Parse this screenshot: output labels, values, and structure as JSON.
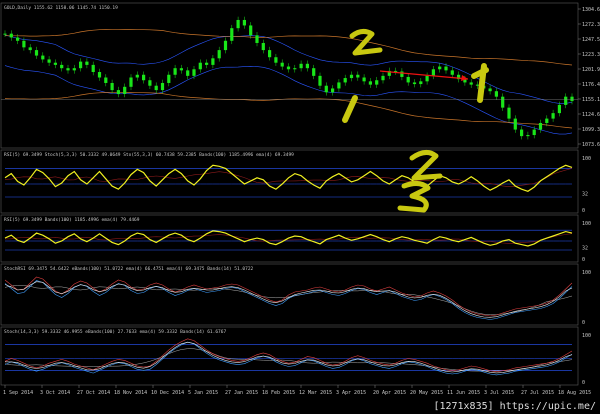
{
  "watermark": "[1271x835] https://upic.me/",
  "colors": {
    "bg": "#000000",
    "candle": "#19e619",
    "band": "#2a56ff",
    "envelope": "#c8742a",
    "yellow": "#f0f020",
    "annot_yellow": "#c8c810",
    "red": "#e11",
    "grid": "#4a4a4a"
  },
  "chart_data": [
    {
      "type": "candlestick",
      "header": "GOLD,Daily  1155.62 1158.06 1145.74 1150.19",
      "ylim": [
        1073.65,
        1320
      ],
      "y_ticks": [
        "1304.65",
        "1272.35",
        "1247.55",
        "1223.35",
        "1201.95",
        "1176.40",
        "1155.19",
        "1124.65",
        "1099.35",
        "1073.65"
      ],
      "current_price": "1155.19",
      "x_ticks": [
        "1 Sep 2014",
        "3 Oct 2014",
        "27 Oct 2014",
        "18 Nov 2014",
        "10 Dec 2014",
        "5 Jan 2015",
        "27 Jan 2015",
        "18 Feb 2015",
        "12 Mar 2015",
        "3 Apr 2015",
        "20 Apr 2015",
        "20 May 2015",
        "11 Jun 2015",
        "3 Jul 2015",
        "27 Jul 2015",
        "18 Aug 2015"
      ],
      "close": [
        1275,
        1268,
        1262,
        1250,
        1245,
        1235,
        1228,
        1222,
        1218,
        1212,
        1208,
        1212,
        1224,
        1218,
        1205,
        1195,
        1185,
        1172,
        1165,
        1178,
        1195,
        1200,
        1190,
        1180,
        1172,
        1185,
        1200,
        1212,
        1208,
        1198,
        1210,
        1222,
        1218,
        1230,
        1245,
        1262,
        1285,
        1300,
        1290,
        1272,
        1258,
        1245,
        1232,
        1222,
        1215,
        1210,
        1212,
        1220,
        1212,
        1198,
        1180,
        1168,
        1175,
        1186,
        1194,
        1200,
        1195,
        1188,
        1182,
        1190,
        1198,
        1207,
        1206,
        1196,
        1186,
        1183,
        1188,
        1198,
        1210,
        1215,
        1208,
        1200,
        1192,
        1186,
        1182,
        1180,
        1175,
        1170,
        1160,
        1140,
        1120,
        1100,
        1088,
        1090,
        1100,
        1112,
        1120,
        1130,
        1145,
        1160,
        1152
      ]
    },
    {
      "type": "line",
      "header": "RSI(5) 69.3499  Stoch(5,3,3) 50.3332  49.0649  Sto(55,3,3) 60.7438 59.2385  Bands(100) 1185.4996  ema(4) 69.3499",
      "ylim": [
        0,
        100
      ],
      "y_ticks": [
        "100",
        "32",
        "0"
      ],
      "series_color": "yellow",
      "values": [
        62,
        70,
        55,
        48,
        62,
        78,
        72,
        60,
        45,
        52,
        66,
        74,
        58,
        50,
        62,
        74,
        60,
        46,
        40,
        52,
        68,
        78,
        72,
        56,
        46,
        58,
        70,
        78,
        70,
        56,
        48,
        60,
        76,
        86,
        84,
        80,
        70,
        60,
        50,
        56,
        62,
        58,
        46,
        40,
        50,
        62,
        70,
        66,
        56,
        48,
        42,
        56,
        64,
        70,
        62,
        54,
        58,
        66,
        74,
        66,
        56,
        50,
        58,
        66,
        62,
        54,
        50,
        46,
        56,
        66,
        62,
        54,
        50,
        56,
        64,
        56,
        46,
        38,
        44,
        52,
        58,
        46,
        40,
        36,
        44,
        56,
        64,
        72,
        80,
        86,
        82
      ]
    },
    {
      "type": "line",
      "header": "RSI(5) 69.3499  Bands(100) 1185.4996  ema(4) 79.4469",
      "ylim": [
        0,
        100
      ],
      "y_ticks": [
        "100",
        "32",
        "0"
      ],
      "series_color": "yellow",
      "values": [
        58,
        66,
        52,
        46,
        58,
        72,
        66,
        56,
        44,
        50,
        62,
        70,
        56,
        48,
        58,
        70,
        58,
        46,
        40,
        50,
        64,
        72,
        68,
        54,
        46,
        56,
        66,
        72,
        66,
        54,
        48,
        58,
        70,
        78,
        76,
        72,
        64,
        56,
        48,
        54,
        58,
        54,
        44,
        40,
        48,
        58,
        64,
        62,
        54,
        48,
        42,
        54,
        60,
        66,
        58,
        52,
        56,
        62,
        68,
        62,
        54,
        48,
        56,
        62,
        58,
        52,
        48,
        44,
        54,
        62,
        58,
        52,
        48,
        54,
        60,
        52,
        44,
        38,
        42,
        50,
        54,
        44,
        40,
        36,
        42,
        52,
        58,
        64,
        70,
        76,
        72
      ]
    },
    {
      "type": "line",
      "header": "StochRSI 69.3475 54.6422  eBands(100) 51.0722  ema(4) 66.4751  ema(4) 69.3475  Bands(14) 51.0722",
      "ylim": [
        0,
        100
      ],
      "y_ticks": [
        "100",
        "0"
      ],
      "series_color": "mixed",
      "values": [
        80,
        70,
        60,
        62,
        74,
        86,
        82,
        70,
        58,
        52,
        60,
        72,
        78,
        74,
        64,
        56,
        62,
        72,
        80,
        76,
        66,
        60,
        62,
        70,
        74,
        70,
        62,
        56,
        60,
        66,
        70,
        66,
        62,
        64,
        66,
        70,
        72,
        70,
        64,
        58,
        52,
        46,
        40,
        36,
        40,
        50,
        56,
        58,
        60,
        64,
        66,
        62,
        58,
        56,
        60,
        66,
        70,
        68,
        62,
        58,
        62,
        66,
        60,
        54,
        50,
        46,
        48,
        54,
        58,
        54,
        48,
        40,
        30,
        22,
        16,
        12,
        10,
        8,
        10,
        14,
        18,
        22,
        24,
        26,
        28,
        30,
        34,
        40,
        50,
        62,
        74
      ]
    },
    {
      "type": "line",
      "header": "Stoch(14,3,3) 59.3332 46.9955  eBands(100) 27.7633  ema(4) 59.3332  Bands(14) 61.6767",
      "ylim": [
        0,
        100
      ],
      "y_ticks": [
        "100",
        "0"
      ],
      "series_color": "mixed",
      "values": [
        40,
        46,
        42,
        36,
        30,
        26,
        30,
        36,
        40,
        44,
        40,
        34,
        30,
        26,
        22,
        28,
        34,
        40,
        44,
        42,
        36,
        30,
        28,
        30,
        40,
        52,
        64,
        74,
        82,
        88,
        84,
        74,
        64,
        56,
        50,
        46,
        42,
        40,
        42,
        48,
        54,
        58,
        54,
        46,
        40,
        36,
        38,
        44,
        50,
        48,
        42,
        36,
        32,
        34,
        40,
        48,
        52,
        48,
        42,
        38,
        34,
        32,
        36,
        42,
        46,
        44,
        40,
        36,
        30,
        26,
        22,
        20,
        22,
        26,
        30,
        28,
        24,
        20,
        18,
        20,
        22,
        26,
        28,
        30,
        32,
        34,
        36,
        40,
        46,
        54,
        62
      ]
    }
  ],
  "annotations": [
    "2",
    "1",
    "2",
    "3",
    "1"
  ]
}
